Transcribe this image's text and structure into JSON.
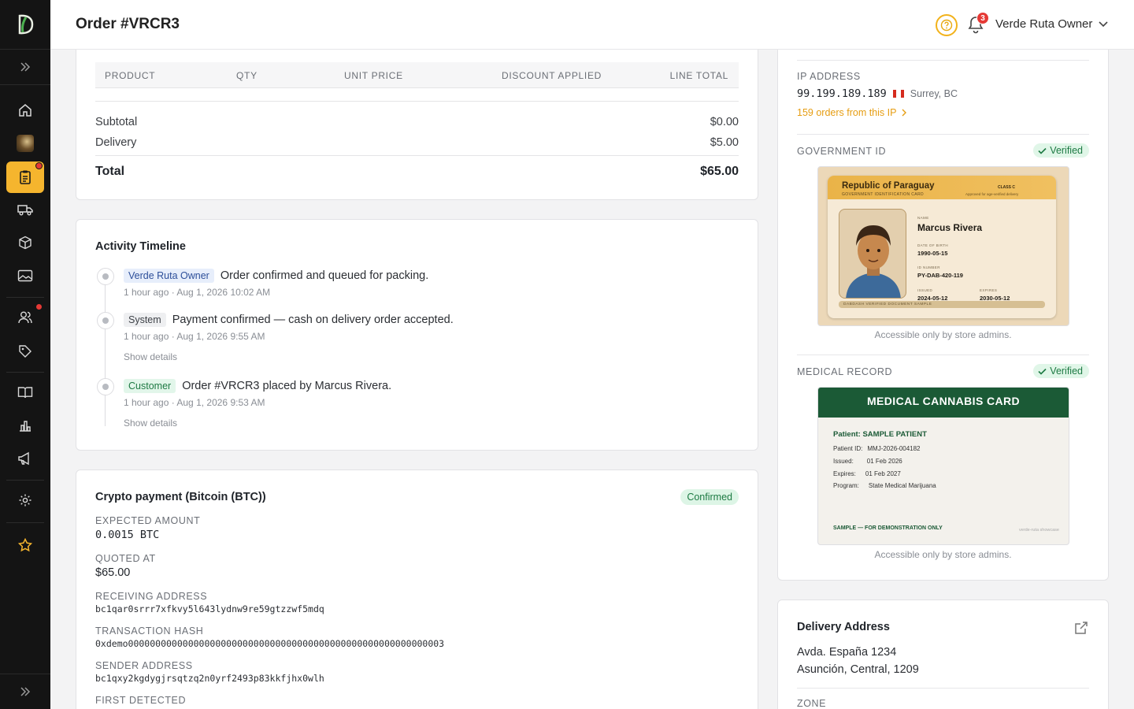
{
  "header": {
    "title": "Order #VRCR3",
    "notifications_count": "3",
    "user_name": "Verde Ruta Owner"
  },
  "items": {
    "columns": [
      "PRODUCT",
      "QTY",
      "UNIT PRICE",
      "DISCOUNT APPLIED",
      "LINE TOTAL"
    ],
    "subtotal_label": "Subtotal",
    "subtotal": "$0.00",
    "delivery_label": "Delivery",
    "delivery": "$5.00",
    "total_label": "Total",
    "total": "$65.00"
  },
  "timeline": {
    "title": "Activity Timeline",
    "events": [
      {
        "actor": "Verde Ruta Owner",
        "text": "Order confirmed and queued for packing.",
        "time": "1 hour ago · Aug 1, 2026 10:02 AM"
      },
      {
        "actor": "System",
        "text": "Payment confirmed — cash on delivery order accepted.",
        "time": "1 hour ago · Aug 1, 2026 9:55 AM",
        "details": "Show details"
      },
      {
        "actor": "Customer",
        "text": "Order #VRCR3 placed by Marcus Rivera.",
        "time": "1 hour ago · Aug 1, 2026 9:53 AM",
        "details": "Show details"
      }
    ]
  },
  "crypto": {
    "title": "Crypto payment (Bitcoin (BTC))",
    "status": "Confirmed",
    "expected_label": "EXPECTED AMOUNT",
    "expected": "0.0015 BTC",
    "quoted_label": "QUOTED AT",
    "quoted": "$65.00",
    "receiving_label": "RECEIVING ADDRESS",
    "receiving": "bc1qar0srrr7xfkvy5l643lydnw9re59gtzzwf5mdq",
    "hash_label": "TRANSACTION HASH",
    "hash": "0xdemo0000000000000000000000000000000000000000000000000000000003",
    "sender_label": "SENDER ADDRESS",
    "sender": "bc1qxy2kgdygjrsqtzq2n0yrf2493p83kkfjhx0wlh",
    "first_detected_label": "FIRST DETECTED"
  },
  "customer_panel": {
    "ip_label": "IP ADDRESS",
    "ip": "99.199.189.189",
    "ip_location": "Surrey, BC",
    "ip_orders_link": "159 orders from this IP",
    "gov_id_label": "GOVERNMENT ID",
    "verified_label": "Verified",
    "id_card": {
      "country": "Republic of Paraguay",
      "subtitle": "GOVERNMENT IDENTIFICATION CARD",
      "class": "CLASS C",
      "note": "Approved for age-verified delivery",
      "name_label": "NAME",
      "name": "Marcus Rivera",
      "dob_label": "DATE OF BIRTH",
      "dob": "1990-05-15",
      "id_label": "ID NUMBER",
      "id_number": "PY-DAB-420-119",
      "issued_label": "ISSUED",
      "issued": "2024-05-12",
      "expires_label": "EXPIRES",
      "expires": "2030-05-12",
      "footer": "DABDASH VERIFIED DOCUMENT SAMPLE"
    },
    "accessible_note": "Accessible only by store admins.",
    "medical_label": "MEDICAL RECORD",
    "medical_card": {
      "title": "MEDICAL CANNABIS CARD",
      "patient": "Patient: SAMPLE PATIENT",
      "patient_id_label": "Patient ID:",
      "patient_id": "MMJ-2026-004182",
      "issued_label": "Issued:",
      "issued": "01 Feb 2026",
      "expires_label": "Expires:",
      "expires": "01 Feb 2027",
      "program_label": "Program:",
      "program": "State Medical Marijuana",
      "footer": "SAMPLE — FOR DEMONSTRATION ONLY",
      "watermark": "verde-ruta showcase"
    }
  },
  "delivery": {
    "title": "Delivery Address",
    "line1": "Avda. España 1234",
    "line2": "Asunción, Central, 1209",
    "zone_label": "ZONE"
  }
}
